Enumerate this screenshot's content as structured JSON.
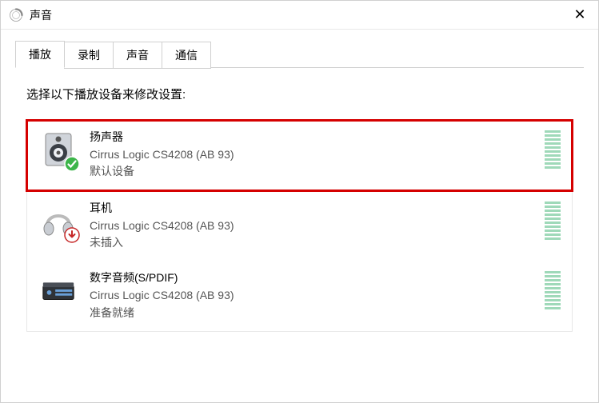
{
  "window": {
    "title": "声音"
  },
  "tabs": {
    "items": [
      {
        "label": "播放",
        "active": true
      },
      {
        "label": "录制",
        "active": false
      },
      {
        "label": "声音",
        "active": false
      },
      {
        "label": "通信",
        "active": false
      }
    ]
  },
  "instruction": "选择以下播放设备来修改设置:",
  "devices": [
    {
      "name": "扬声器",
      "desc": "Cirrus Logic CS4208 (AB 93)",
      "status": "默认设备",
      "icon": "speaker-icon",
      "badge": "check",
      "highlight": true
    },
    {
      "name": "耳机",
      "desc": "Cirrus Logic CS4208 (AB 93)",
      "status": "未插入",
      "icon": "headphones-icon",
      "badge": "down",
      "highlight": false
    },
    {
      "name": "数字音频(S/PDIF)",
      "desc": "Cirrus Logic CS4208 (AB 93)",
      "status": "准备就绪",
      "icon": "spdif-icon",
      "badge": null,
      "highlight": false
    }
  ]
}
